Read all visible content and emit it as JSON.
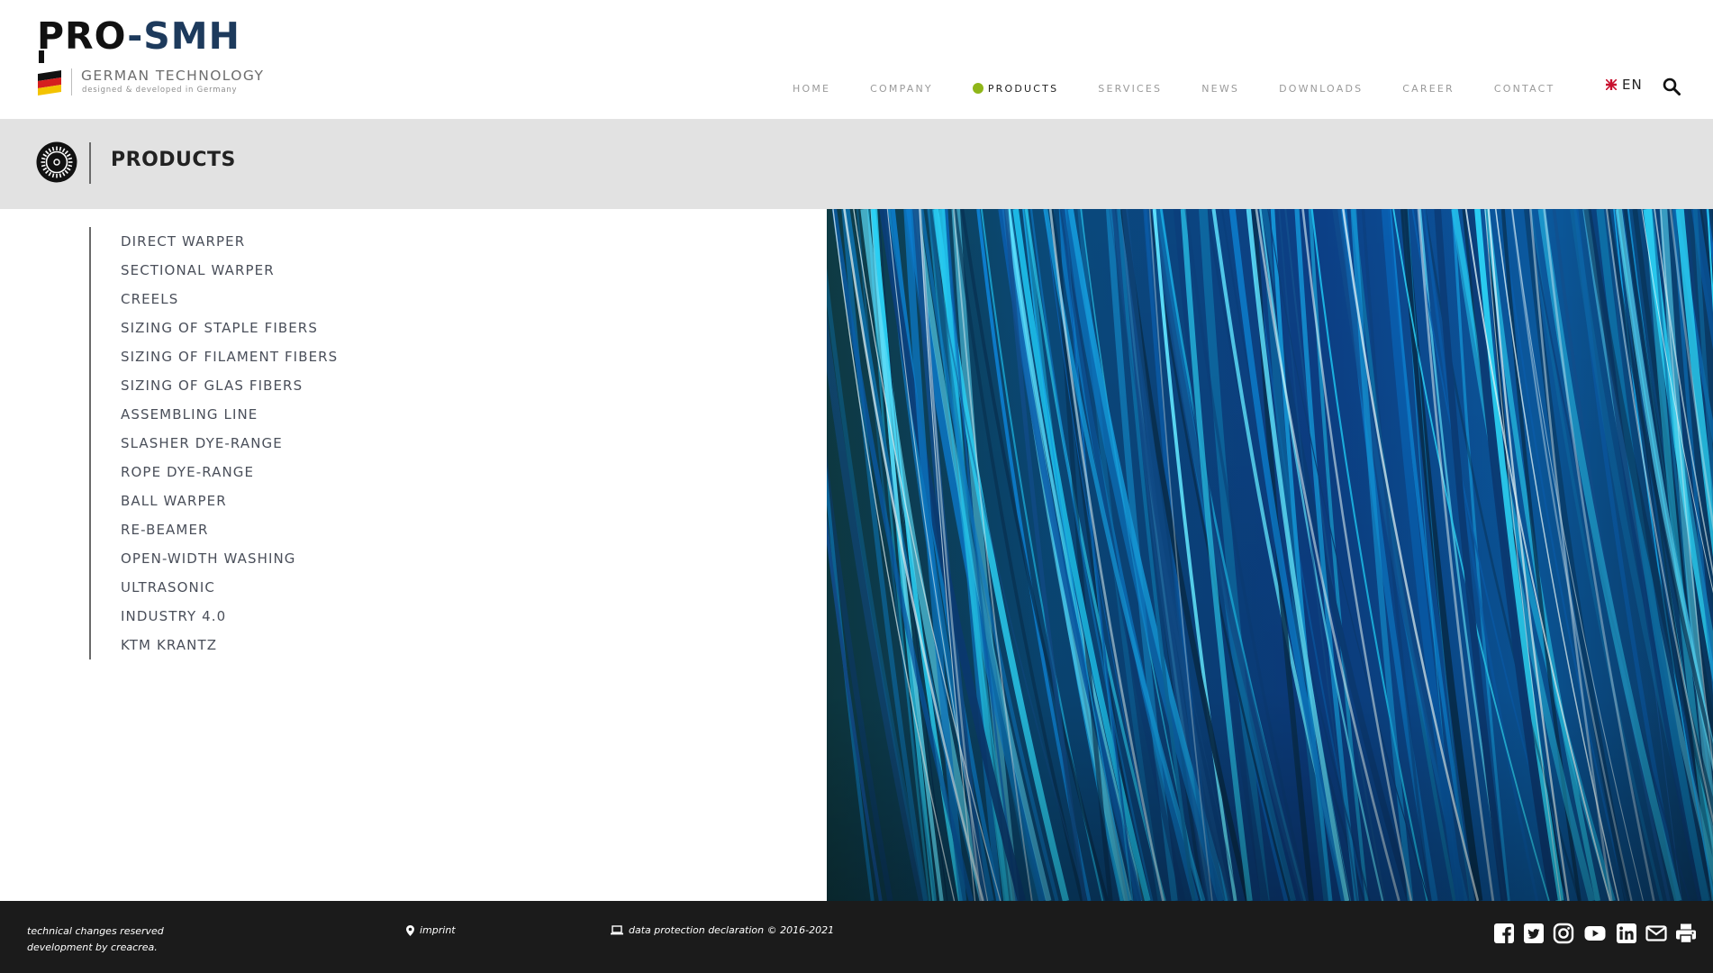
{
  "brand": {
    "name_part1": "PRO",
    "name_dash": "-",
    "name_part2": "SMH",
    "subtitle": "GERMAN TECHNOLOGY",
    "tagline": "designed & developed in Germany"
  },
  "nav": {
    "items": [
      {
        "label": "HOME"
      },
      {
        "label": "COMPANY"
      },
      {
        "label": "PRODUCTS"
      },
      {
        "label": "SERVICES"
      },
      {
        "label": "NEWS"
      },
      {
        "label": "DOWNLOADS"
      },
      {
        "label": "CAREER"
      },
      {
        "label": "CONTACT"
      }
    ],
    "active": "PRODUCTS",
    "active_color": "#8fb619",
    "language": "EN"
  },
  "page": {
    "title": "PRODUCTS"
  },
  "products": [
    "DIRECT WARPER",
    "SECTIONAL WARPER",
    "CREELS",
    "SIZING OF STAPLE FIBERS",
    "SIZING OF FILAMENT FIBERS",
    "SIZING OF GLAS FIBERS",
    "ASSEMBLING LINE",
    "SLASHER DYE-RANGE",
    "ROPE DYE-RANGE",
    "BALL WARPER",
    "RE-BEAMER",
    "OPEN-WIDTH WASHING",
    "ULTRASONIC",
    "INDUSTRY 4.0",
    "KTM KRANTZ"
  ],
  "footer": {
    "line1": "technical changes reserved",
    "line2": "development by creacrea.",
    "imprint": "imprint",
    "privacy": "data protection declaration © 2016-2021",
    "social_icons": [
      "facebook-icon",
      "twitter-icon",
      "instagram-icon",
      "youtube-icon",
      "linkedin-icon",
      "mail-icon",
      "print-icon"
    ]
  },
  "colors": {
    "brand_dark": "#111111",
    "brand_blue": "#1d3a5c",
    "band_bg": "#e2e2e2",
    "footer_bg": "#1b1b1b"
  }
}
